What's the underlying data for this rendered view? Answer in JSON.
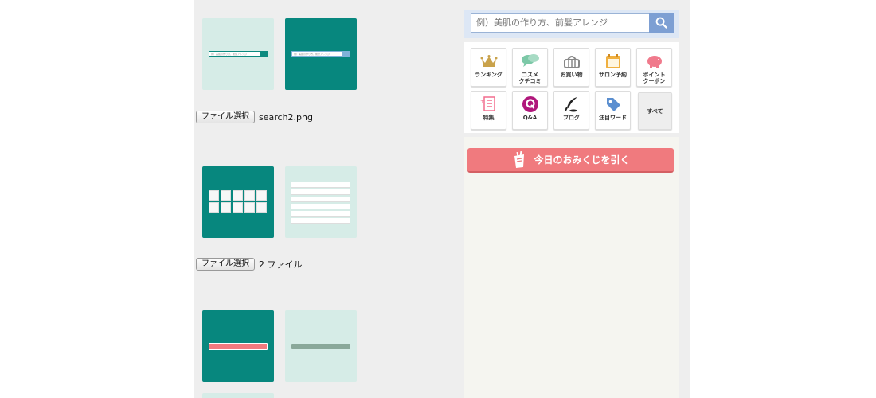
{
  "upload_blocks": [
    {
      "file_button": "ファイル選択",
      "file_status": "search2.png"
    },
    {
      "file_button": "ファイル選択",
      "file_status": "2 ファイル"
    }
  ],
  "search": {
    "placeholder": "例）美肌の作り方、前髪アレンジ",
    "button_icon": "search-icon"
  },
  "menu": [
    {
      "label": "ランキング",
      "icon": "crown-icon",
      "color": "#c9a24b"
    },
    {
      "label": "コスメ\nクチコミ",
      "icon": "speech-bubbles-icon",
      "color": "#7cc8a7"
    },
    {
      "label": "お買い物",
      "icon": "shopping-basket-icon",
      "color": "#888888"
    },
    {
      "label": "サロン予約",
      "icon": "calendar-icon",
      "color": "#f0b040"
    },
    {
      "label": "ポイント\nクーポン",
      "icon": "piggy-bank-icon",
      "color": "#f07a8c"
    },
    {
      "label": "特集",
      "icon": "magazine-icon",
      "color": "#f26d8e"
    },
    {
      "label": "Q&A",
      "icon": "qa-icon",
      "color": "#b0177b"
    },
    {
      "label": "ブログ",
      "icon": "pen-icon",
      "color": "#222222"
    },
    {
      "label": "注目ワード",
      "icon": "tag-icon",
      "color": "#5b8fd0"
    },
    {
      "label": "すべて",
      "icon": "",
      "color": "#333333"
    }
  ],
  "omikuji": {
    "label": "今日のおみくじを引く",
    "icon": "omikuji-icon",
    "color": "#f07a7e"
  },
  "colors": {
    "teal": "#07877e",
    "mint": "#d6ece7",
    "panel": "#eeeeee"
  }
}
